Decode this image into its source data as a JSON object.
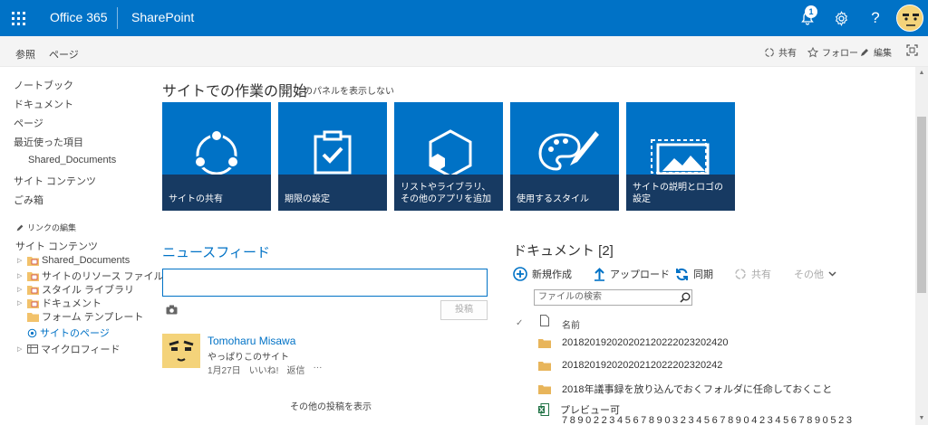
{
  "suite_bar": {
    "app_name": "Office 365",
    "site_name": "SharePoint",
    "notification_count": "1",
    "help_label": "?"
  },
  "ribbon": {
    "tabs": [
      "参照",
      "ページ"
    ],
    "actions": {
      "share": "共有",
      "follow": "フォロー",
      "edit": "編集"
    }
  },
  "left_nav": {
    "items": [
      "ノートブック",
      "ドキュメント",
      "ページ",
      "最近使った項目",
      "Shared_Documents",
      "サイト コンテンツ",
      "ごみ箱"
    ],
    "edit_links": "リンクの編集",
    "tree_heading": "サイト コンテンツ",
    "tree": [
      "Shared_Documents",
      "サイトのリソース ファイル",
      "スタイル ライブラリ",
      "ドキュメント",
      "フォーム テンプレート",
      "サイトのページ",
      "マイクロフィード"
    ]
  },
  "getting_started": {
    "title": "サイトでの作業の開始",
    "hide_link": "このパネルを表示しない",
    "tiles": [
      {
        "label": "サイトの共有",
        "icon": "share-icon"
      },
      {
        "label": "期限の設定",
        "icon": "clipboard-check-icon"
      },
      {
        "label": "リストやライブラリ、その他のアプリを追加",
        "icon": "hexagon-add-icon"
      },
      {
        "label": "使用するスタイル",
        "icon": "palette-icon"
      },
      {
        "label": "サイトの説明とロゴの設定",
        "icon": "image-icon"
      }
    ]
  },
  "newsfeed": {
    "title": "ニュースフィード",
    "input_value": "",
    "post_button": "投稿",
    "post": {
      "user": "Tomoharu Misawa",
      "text": "やっぱりこのサイト",
      "date": "1月27日",
      "like": "いいね!",
      "reply": "返信",
      "more": "···"
    },
    "show_more": "その他の投稿を表示"
  },
  "documents": {
    "title": "ドキュメント [2]",
    "actions": {
      "new": "新規作成",
      "upload": "アップロード",
      "sync": "同期",
      "share": "共有",
      "other": "その他"
    },
    "search_placeholder": "ファイルの検索",
    "col_name": "名前",
    "rows": [
      {
        "name": "2018201920202021202220232024​20",
        "type": "folder"
      },
      {
        "name": "20182019202020212022202320242",
        "type": "folder"
      },
      {
        "name": "2018年議事録を放り込んでおくフォルダに任命しておくこと",
        "type": "folder"
      },
      {
        "name": "プレビュー可",
        "type": "excel"
      }
    ],
    "bottom_digits": "7890223456789032345678904234567890523"
  },
  "colors": {
    "brand_blue": "#0072c6",
    "tile_band": "#173a62"
  }
}
